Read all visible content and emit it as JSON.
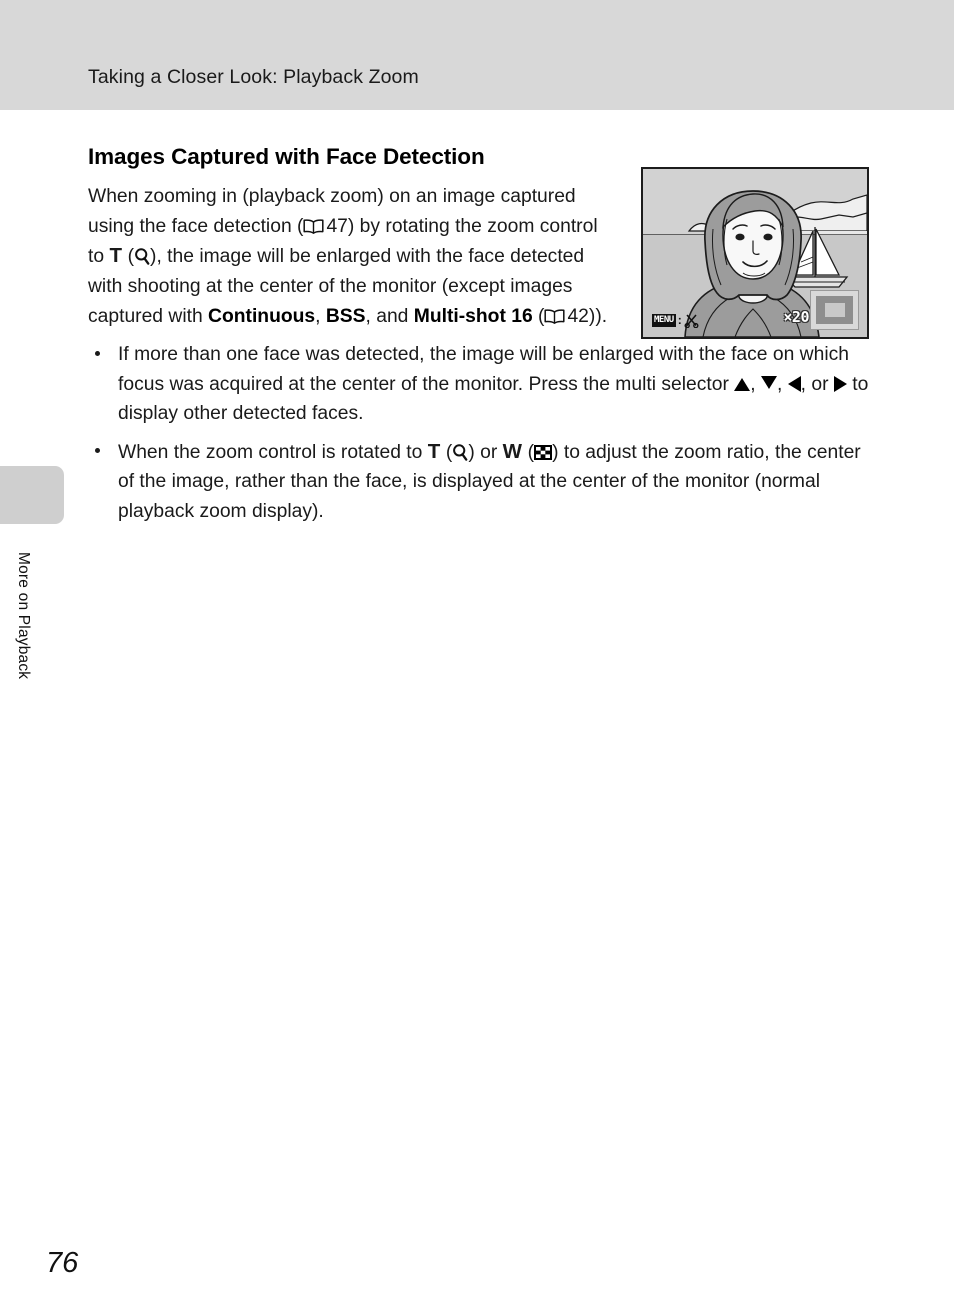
{
  "header": {
    "running_title": "Taking a Closer Look: Playback Zoom"
  },
  "side_tab": {
    "label": "More on Playback"
  },
  "footer": {
    "page_number": "76"
  },
  "section": {
    "heading": "Images Captured with Face Detection",
    "intro": {
      "seg1": "When zooming in (playback zoom) on an image captured using the face detection (",
      "ref1_page": "47",
      "seg2": ") by rotating the zoom control to ",
      "ctrl_tele": "T",
      "seg3": "), the image will be enlarged with the face detected with shooting at the center of the monitor (except images captured with ",
      "bold_continuous": "Continuous",
      "seg4": ", ",
      "bold_bss": "BSS",
      "seg5": ", and ",
      "bold_multishot": "Multi-shot 16",
      "seg6": " (",
      "ref2_page": "42",
      "seg7": "))."
    },
    "bullets": [
      {
        "seg1": "If more than one face was detected, the image will be enlarged with the face on which focus was acquired at the center of the monitor. Press the multi selector ",
        "seg2": ", ",
        "seg3": ", ",
        "seg4": ", or ",
        "seg5": " to display other detected faces."
      },
      {
        "seg1": "When the zoom control is rotated to ",
        "ctrl_tele": "T",
        "seg2": " (",
        "seg3": ") or ",
        "ctrl_wide": "W",
        "seg4": " (",
        "seg5": ") to adjust the zoom ratio, the center of the image, rather than the face, is displayed at the center of the monitor (normal playback zoom display)."
      }
    ]
  },
  "monitor": {
    "caption_scene": "portrait of woman with seascape, sailboat and mountains",
    "menu_chip_label": "MENU",
    "menu_colon": ":",
    "zoom_ratio_label": "×20",
    "icons": {
      "crop": "scissors-icon",
      "nav": "navigation-indicator-icon"
    }
  },
  "icons": {
    "book": "open-book-reference-icon",
    "magnifier": "magnifier-tele-zoom-icon",
    "thumbnail_grid": "thumbnail-wide-zoom-icon",
    "tri_up": "multi-selector-up-icon",
    "tri_down": "multi-selector-down-icon",
    "tri_left": "multi-selector-left-icon",
    "tri_right": "multi-selector-right-icon"
  },
  "colors": {
    "header_band": "#d8d8d8",
    "side_tab": "#cfcfcf",
    "monitor_sky": "#d2d2d2",
    "text": "#1a1a1a"
  }
}
